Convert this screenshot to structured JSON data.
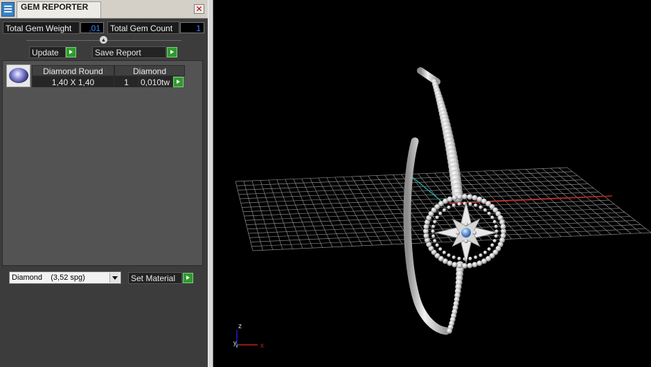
{
  "window": {
    "title": "GEM REPORTER",
    "close_glyph": "✕"
  },
  "stats": {
    "weight_label": "Total Gem Weight",
    "weight_value": ",01",
    "count_label": "Total Gem Count",
    "count_value": "1"
  },
  "actions": {
    "update_label": "Update",
    "save_report_label": "Save Report"
  },
  "table": {
    "headers": [
      "Diamond Round",
      "Diamond"
    ],
    "rows": [
      {
        "size": "1,40 X 1,40",
        "count": "1",
        "weight": "0,010tw"
      }
    ]
  },
  "material": {
    "selected_name": "Diamond",
    "selected_sg": "(3,52 spg)",
    "set_label": "Set Material"
  },
  "viewport": {
    "axis_z": "z",
    "axis_y": "y",
    "axis_x": "x",
    "colors": {
      "axis_x": "#c02020",
      "axis_y": "#20a0a0",
      "axis_z": "#2020c0",
      "grid": "#8a8a8a"
    }
  }
}
